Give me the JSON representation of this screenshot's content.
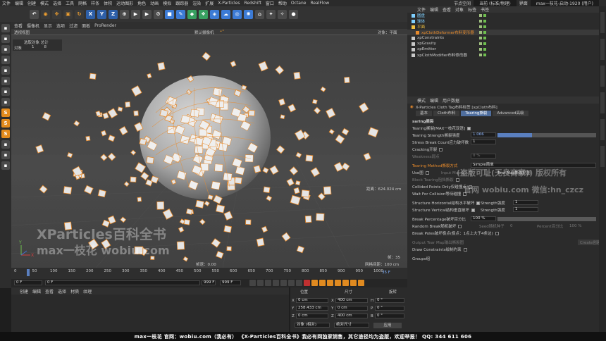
{
  "menubar": [
    "文件",
    "编辑",
    "创建",
    "模式",
    "选择",
    "工具",
    "网格",
    "样条",
    "体积",
    "运动图形",
    "角色",
    "动画",
    "模拟",
    "跟踪器",
    "渲染",
    "扩展",
    "X-Particles",
    "Redshift",
    "窗口",
    "帮助",
    "Octane",
    "RealFlow"
  ],
  "layout": {
    "label": "节点空间",
    "value": "当前 (标准/物理)",
    "ui_label": "界面",
    "ui_value": "max一枝花-启动-1920 (用户)"
  },
  "toolbar_icons": [
    "undo-icon",
    "select-icon",
    "move-icon",
    "scale-icon",
    "rotate-icon",
    "x-axis-icon",
    "y-axis-icon",
    "z-axis-icon",
    "coord-icon",
    "render-icon",
    "render-view-icon",
    "render-settings-icon",
    "cube-icon",
    "pen-icon",
    "subdivide-icon",
    "cloner-icon",
    "deformer-icon",
    "environment-icon",
    "camera-icon",
    "light-icon",
    "tag-icon",
    "xp-icon",
    "xp2-icon",
    "python-icon"
  ],
  "viewport": {
    "menu": [
      "查看",
      "摄像机",
      "显示",
      "选项",
      "过滤",
      "面板",
      "ProRender"
    ],
    "title": "透视视图",
    "camera": "默认摄像机",
    "camera_icon": "•°",
    "object_label": "对象：平面",
    "stats_header": "选取对象  总计",
    "stats_row_label": "对象",
    "stats_selected": "1",
    "stats_total": "8",
    "distance": "距离：624.024 cm",
    "fps": "帧：35",
    "speed": "帧速：0.00",
    "grid": "网格间距：100 cm",
    "watermark1": "XParticles百科全书",
    "watermark2": "max一枝花 wobiu.com"
  },
  "timeline": {
    "ticks": [
      "0",
      "50",
      "100",
      "150",
      "200",
      "250",
      "300",
      "350",
      "400",
      "450",
      "500",
      "550",
      "600",
      "650",
      "700",
      "750",
      "800",
      "850",
      "900",
      "950",
      "1000"
    ],
    "current_frame": "35 F",
    "start": "0 F",
    "min": "0 F",
    "end": "999 F",
    "max": "999 F"
  },
  "material": {
    "menu": [
      "创建",
      "编辑",
      "查看",
      "选择",
      "材质",
      "纹理"
    ]
  },
  "coord": {
    "headers": [
      "位置",
      "尺寸",
      "旋转"
    ],
    "rows": [
      {
        "axis": "X",
        "pos": "0 cm",
        "size": "400 cm",
        "rlabel": "H",
        "rot": "0 °"
      },
      {
        "axis": "Y",
        "pos": "258.433 cm",
        "size": "0 cm",
        "rlabel": "P",
        "rot": "0 °"
      },
      {
        "axis": "Z",
        "pos": "0 cm",
        "size": "400 cm",
        "rlabel": "B",
        "rot": "0 °"
      }
    ],
    "mode1": "对象 (相对)",
    "mode2": "绝对尺寸",
    "apply": "应用"
  },
  "objects": {
    "menu": [
      "文件",
      "编辑",
      "查看",
      "对象",
      "标签",
      "书签"
    ],
    "items": [
      {
        "name": "圆盘",
        "color": "#7fd0ff",
        "indent": 0,
        "selected": false
      },
      {
        "name": "球体",
        "color": "#7fd0ff",
        "indent": 0,
        "selected": false
      },
      {
        "name": "平面",
        "color": "#f0c040",
        "indent": 0,
        "selected": false
      },
      {
        "name": "xpClothDeformer布料变形器",
        "color": "#e88b2c",
        "indent": 1,
        "selected": true
      },
      {
        "name": "xpConstraints",
        "color": "#c8c8c8",
        "indent": 0,
        "selected": false
      },
      {
        "name": "xpGravity",
        "color": "#c8c8c8",
        "indent": 0,
        "selected": false
      },
      {
        "name": "xpEmitter",
        "color": "#c8c8c8",
        "indent": 0,
        "selected": false
      },
      {
        "name": "xpClothModifier布料修改器",
        "color": "#c8c8c8",
        "indent": 0,
        "selected": false
      }
    ]
  },
  "attributes": {
    "menu": [
      "模式",
      "编辑",
      "用户数据"
    ],
    "title": "X-Particles Cloth Tag布料标签 [xpCloth布料]",
    "tabs": [
      "基本",
      "Cloth布料",
      "Tearing撕裂",
      "Advanced高级"
    ],
    "active_tab": 2,
    "section": "saring撕裂",
    "rows": {
      "tearing": "Tearing撕裂[MAX一枝花双语]",
      "strength": "Tearing Strength撕裂强度",
      "strength_val": "1.066",
      "stress": "Stress Break Count应力破坏数",
      "stress_val": "1",
      "cracking": "Cracking开裂",
      "weakness": "Weakness弱点",
      "weakness_val": "0 %",
      "method": "Tearing Method撕裂方式",
      "method_val": "Simple简单",
      "usemap": "Use图",
      "inputmap": "Input Map输入图",
      "tearmap": "Tear Map撕裂贴图",
      "block": "Block Tearing阻挡撕裂",
      "collided": "Collided Points Only仅碰撞点",
      "wait": "Wait For Collision等待碰撞",
      "horiz": "Structure Horizontal结构水平破坏",
      "vert": "Structure Vertical结构垂直破坏",
      "str_label": "Strength强度",
      "str_val": "1",
      "percent": "Break Percentage破坏百分比",
      "percent_val": "100 %",
      "random": "Random Break随机破坏",
      "seed": "Seed随机种子",
      "seed_val": "0",
      "percent2": "Percent百分比",
      "percent2_val": "100 %",
      "poles": "Break Poles破坏极点(极点：1点上大于4条边)",
      "output": "Output Tear Map输出撕裂图",
      "create": "Create创建",
      "draw": "Draw Constraints绘制约束",
      "groups": "Groups组"
    },
    "watermark": "(盗版可耻(无良商家)) 版权所有",
    "watermark2": "官网 wobiu.com 微信:hn_czcz"
  },
  "banner": "max一枝花 官网：wobiu.com（我必有） 《X-Particles百科全书》我必有网独家销售，其它途径均为盗版，欢迎举报！ QQ: 344 611 606",
  "colors": {
    "accent": "#e88b2c",
    "selected_tab": "#4f6e9e",
    "slider_fill": "#5a7fbf"
  }
}
